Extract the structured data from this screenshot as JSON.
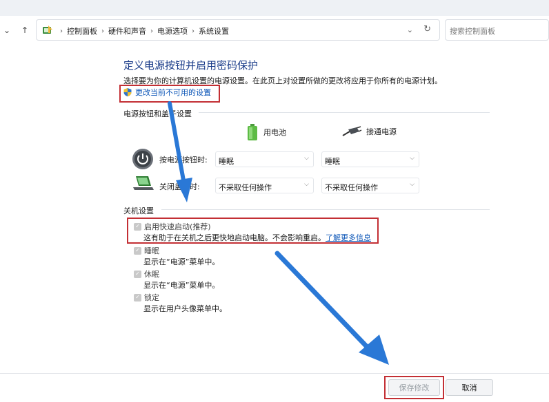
{
  "nav": {
    "breadcrumbs": [
      "控制面板",
      "硬件和声音",
      "电源选项",
      "系统设置"
    ],
    "search_placeholder": "搜索控制面板"
  },
  "page": {
    "title": "定义电源按钮并启用密码保护",
    "subtitle": "选择要为你的计算机设置的电源设置。在此页上对设置所做的更改将应用于你所有的电源计划。",
    "change_link": "更改当前不可用的设置"
  },
  "power_buttons": {
    "group_title": "电源按钮和盖子设置",
    "col_battery": "用电池",
    "col_plugged": "接通电源",
    "rows": [
      {
        "label": "按电源按钮时:",
        "battery": "睡眠",
        "plugged": "睡眠"
      },
      {
        "label": "关闭盖子时:",
        "battery": "不采取任何操作",
        "plugged": "不采取任何操作"
      }
    ]
  },
  "shutdown": {
    "group_title": "关机设置",
    "items": [
      {
        "label": "启用快速启动(推荐)",
        "desc": "这有助于在关机之后更快地启动电脑。不会影响重启。",
        "link": "了解更多信息"
      },
      {
        "label": "睡眠",
        "desc": "显示在“电源”菜单中。"
      },
      {
        "label": "休眠",
        "desc": "显示在“电源”菜单中。"
      },
      {
        "label": "锁定",
        "desc": "显示在用户头像菜单中。"
      }
    ]
  },
  "footer": {
    "save": "保存修改",
    "cancel": "取消"
  },
  "colors": {
    "highlight": "#c32f34",
    "arrow": "#2a78d6",
    "link": "#0b55b7",
    "title": "#1b3d8a"
  }
}
